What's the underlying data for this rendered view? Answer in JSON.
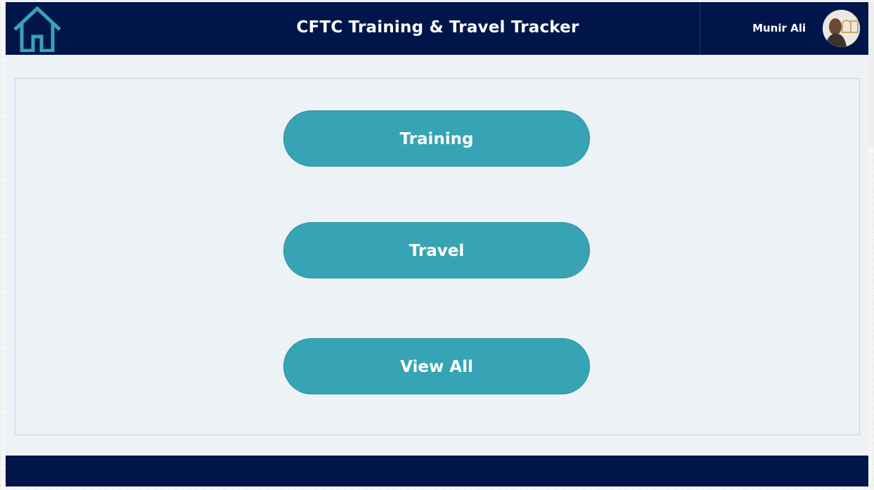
{
  "header": {
    "title": "CFTC Training & Travel Tracker",
    "user_name": "Munir Ali",
    "home_icon": "home-icon",
    "avatar_icon": "user-avatar"
  },
  "main": {
    "buttons": [
      {
        "label": "Training"
      },
      {
        "label": "Travel"
      },
      {
        "label": "View All"
      }
    ]
  },
  "colors": {
    "header_bg": "#00154a",
    "accent": "#37a4b5",
    "page_bg": "#edf2f7"
  }
}
